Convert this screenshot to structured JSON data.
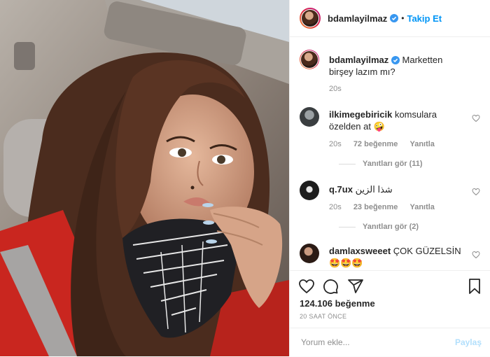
{
  "author": {
    "username": "bdamlayilmaz",
    "separator": "•",
    "follow_label": "Takip Et"
  },
  "caption": {
    "username": "bdamlayilmaz",
    "text": "Marketten birşey lazım mı?",
    "time": "20s"
  },
  "comments": [
    {
      "username": "ilkimegebiricik",
      "text": "komsulara özelden at 🤪",
      "time": "20s",
      "likes": "72 beğenme",
      "reply_label": "Yanıtla",
      "view_replies": "Yanıtları gör (11)"
    },
    {
      "username": "q.7ux",
      "text": "شذا الزين",
      "time": "20s",
      "likes": "23 beğenme",
      "reply_label": "Yanıtla",
      "view_replies": "Yanıtları gör (2)"
    },
    {
      "username": "damlaxsweeet",
      "text": "ÇOK GÜZELSİN🤩🤩🤩"
    }
  ],
  "engagement": {
    "likes": "124.106 beğenme",
    "posted_ago": "20 SAAT ÖNCE"
  },
  "comment_box": {
    "placeholder": "Yorum ekle...",
    "submit_label": "Paylaş"
  },
  "icons": {
    "like": "heart-icon",
    "comment": "comment-icon",
    "share": "share-icon",
    "save": "bookmark-icon",
    "verified": "verified-badge-icon"
  },
  "colors": {
    "link": "#0095f6",
    "muted": "#8e8e8e",
    "text": "#262626",
    "disabled_link": "#b2dffc"
  }
}
